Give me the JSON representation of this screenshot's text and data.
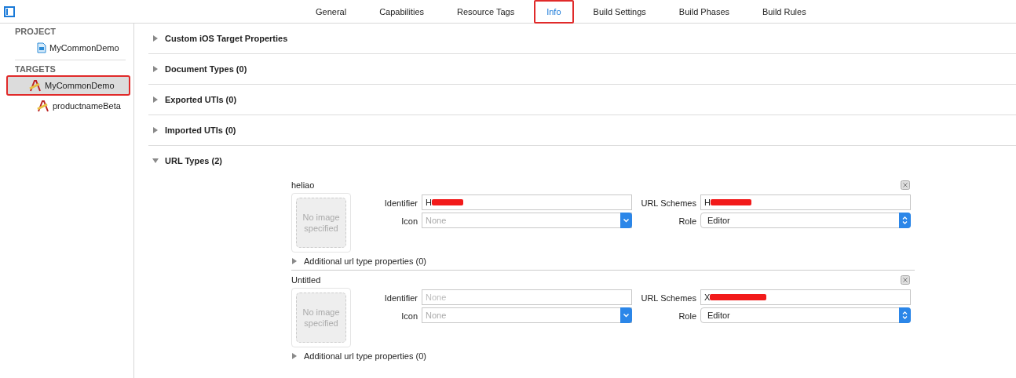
{
  "tabs": [
    {
      "label": "General",
      "selected": false,
      "annotated": false
    },
    {
      "label": "Capabilities",
      "selected": false,
      "annotated": false
    },
    {
      "label": "Resource Tags",
      "selected": false,
      "annotated": false
    },
    {
      "label": "Info",
      "selected": true,
      "annotated": true
    },
    {
      "label": "Build Settings",
      "selected": false,
      "annotated": false
    },
    {
      "label": "Build Phases",
      "selected": false,
      "annotated": false
    },
    {
      "label": "Build Rules",
      "selected": false,
      "annotated": false
    }
  ],
  "sidebar": {
    "groups": [
      {
        "heading": "PROJECT",
        "items": [
          {
            "label": "MyCommonDemo",
            "kind": "project",
            "selected": false,
            "annotated": false
          }
        ]
      },
      {
        "heading": "TARGETS",
        "items": [
          {
            "label": "MyCommonDemo",
            "kind": "target",
            "selected": true,
            "annotated": true
          },
          {
            "label": "productnameBeta",
            "kind": "target",
            "selected": false,
            "annotated": false
          }
        ]
      }
    ]
  },
  "sections": [
    {
      "title": "Custom iOS Target Properties",
      "expanded": false
    },
    {
      "title": "Document Types (0)",
      "expanded": false
    },
    {
      "title": "Exported UTIs (0)",
      "expanded": false
    },
    {
      "title": "Imported UTIs (0)",
      "expanded": false
    },
    {
      "title": "URL Types (2)",
      "expanded": true
    }
  ],
  "url_types": [
    {
      "name": "heliao",
      "image_placeholder": "No image specified",
      "identifier_label": "Identifier",
      "identifier": {
        "value": "H",
        "redacted": true
      },
      "icon_label": "Icon",
      "icon": "None",
      "schemes_label": "URL Schemes",
      "schemes": {
        "value": "H",
        "redacted": true
      },
      "role_label": "Role",
      "role": "Editor",
      "additional": "Additional url type properties (0)"
    },
    {
      "name": "Untitled",
      "image_placeholder": "No image specified",
      "identifier_label": "Identifier",
      "identifier": {
        "placeholder": "None",
        "redacted": false
      },
      "icon_label": "Icon",
      "icon": "None",
      "schemes_label": "URL Schemes",
      "schemes": {
        "value": "X",
        "redacted": true
      },
      "role_label": "Role",
      "role": "Editor",
      "additional": "Additional url type properties (0)"
    }
  ]
}
